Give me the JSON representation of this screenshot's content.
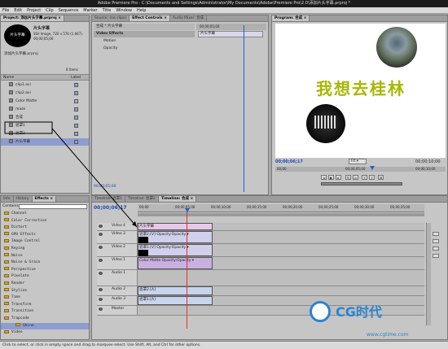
{
  "app": {
    "title": "Adobe Premiere Pro - C:\\Documents and Settings\\Administrator\\My Documents\\Adobe\\Premiere Pro\\2.0\\添加片头字幕.prproj *"
  },
  "menu": [
    "File",
    "Edit",
    "Project",
    "Clip",
    "Sequence",
    "Marker",
    "Title",
    "Window",
    "Help"
  ],
  "project": {
    "tab": "Project: 添加片头字幕.prproj ×",
    "clip_name": "片头字幕",
    "clip_info": "Still Image, 720 x 576 (1.067)",
    "clip_info2": "00;00;05;00",
    "preview_text": "片头字幕",
    "proj_name": "添加片头字幕.prproj",
    "items_count": "8 Items",
    "col_name": "Name",
    "col_label": "Label",
    "items": [
      {
        "name": "clip1.avi",
        "color": "#8fa2d6"
      },
      {
        "name": "clip2.avi",
        "color": "#8fa2d6"
      },
      {
        "name": "Color Matte",
        "color": "#c2a1d9"
      },
      {
        "name": "mask",
        "color": "#8fa2d6"
      },
      {
        "name": "合成",
        "color": "#8fa2d6"
      },
      {
        "name": "遮罩1",
        "color": "#8fa2d6"
      },
      {
        "name": "遮罩2",
        "color": "#8fa2d6"
      },
      {
        "name": "片头字幕",
        "color": "#8fa2d6"
      }
    ],
    "bottom_tabs": [
      "Info",
      "History",
      "Effects ×"
    ]
  },
  "effects_panel": {
    "search": "Contains:",
    "items": [
      "Channel",
      "Color Correction",
      "Distort",
      "GPU Effects",
      "Image Control",
      "Keying",
      "Noise",
      "Noise & Grain",
      "Perspective",
      "Pixelate",
      "Render",
      "Stylize",
      "Time",
      "Transform",
      "Transition",
      "Trapcode",
      "Shine",
      "Video"
    ]
  },
  "source": {
    "tabs": [
      "Source: (no clips)",
      "Effect Controls ×",
      "Audio Mixer: 合成"
    ],
    "header": "合成 * 片头字幕",
    "section": "Video Effects",
    "motion": "Motion",
    "opacity": "Opacity",
    "clip_label": "片头字幕",
    "timecode": "00;00;05;00",
    "ruler": "00;00;05;00"
  },
  "program": {
    "tab": "Program: 合成 ×",
    "title_text": "我想去桂林",
    "timecode_left": "00;00;06;17",
    "fit": "Fit",
    "timecode_right": "00;00;10;00",
    "ruler": [
      "00;00",
      "00;00;05;00",
      "00;00;10;00"
    ]
  },
  "timeline": {
    "tabs": [
      "Timeline: 遮罩1",
      "Timeline: 遮罩2",
      "Timeline: 合成 ×"
    ],
    "timecode": "00;00;06;17",
    "ruler": [
      "00;00",
      "00;00;05;00",
      "00;00;10;00",
      "00;00;15;00",
      "00;00;20;00",
      "00;00;25;00",
      "00;00;30;00",
      "00;00;35;00"
    ],
    "tracks": [
      {
        "name": "Video 4",
        "clip": "片头字幕"
      },
      {
        "name": "Video 3",
        "clip": "遮罩2.[V] Opacity:Opacity ▾"
      },
      {
        "name": "Video 2",
        "clip": "遮罩1.[V] Opacity:Opacity ▾"
      },
      {
        "name": "Video 1",
        "clip": "Color Matte Opacity:Opacity ▾"
      },
      {
        "name": "Audio 1",
        "clip": ""
      },
      {
        "name": "Audio 2",
        "clip": "遮罩2.[A]"
      },
      {
        "name": "Audio 3",
        "clip": "遮罩1.[A]"
      },
      {
        "name": "Master",
        "clip": ""
      }
    ]
  },
  "status": "Click to select, or click in empty space and drag to marquee select. Use Shift, Alt, and Ctrl for other options.",
  "watermark": {
    "brand": "CG时代",
    "url": "www.cgtime.com"
  }
}
